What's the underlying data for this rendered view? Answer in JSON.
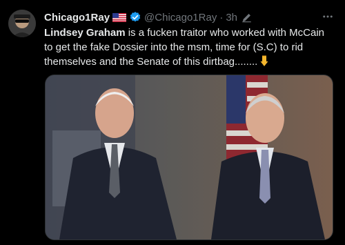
{
  "tweet": {
    "display_name": "Chicago1Ray",
    "handle": "@Chicago1Ray",
    "separator": "·",
    "time": "3h",
    "text_mention": "Lindsey Graham",
    "text_body": " is a fucken traitor who worked with McCain to get the fake Dossier into the msm, time for (S.C) to rid themselves and the Senate of this dirtbag........",
    "emoji": "pointing-down-emoji"
  },
  "icons": {
    "flag": "us-flag-icon",
    "verified": "verified-badge-icon",
    "edited": "edit-pencil-icon",
    "more": "more-options-icon"
  },
  "colors": {
    "background": "#000000",
    "text": "#e7e9ea",
    "secondary": "#71767b",
    "verified": "#1d9bf0"
  }
}
